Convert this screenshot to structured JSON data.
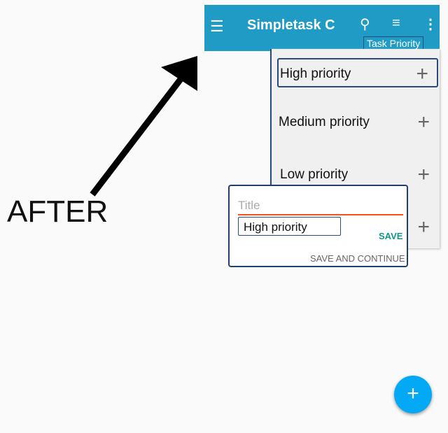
{
  "annotation": {
    "label": "AFTER"
  },
  "appbar": {
    "title": "Simpletask C",
    "sort_label": "Task Priority",
    "icons": [
      "menu-icon",
      "search-icon",
      "filter-icon",
      "more-vert-icon"
    ],
    "color": "#1f9bc6"
  },
  "dropdown": {
    "items": [
      {
        "label": "High priority",
        "selected": true
      },
      {
        "label": "Medium priority"
      },
      {
        "label": "Low priority"
      }
    ]
  },
  "dialog": {
    "title_placeholder": "Title",
    "priority_value": "High priority",
    "save": "SAVE",
    "save_continue": "SAVE AND CONTINUE"
  },
  "fab": {
    "icon": "plus-icon",
    "label": "+"
  }
}
